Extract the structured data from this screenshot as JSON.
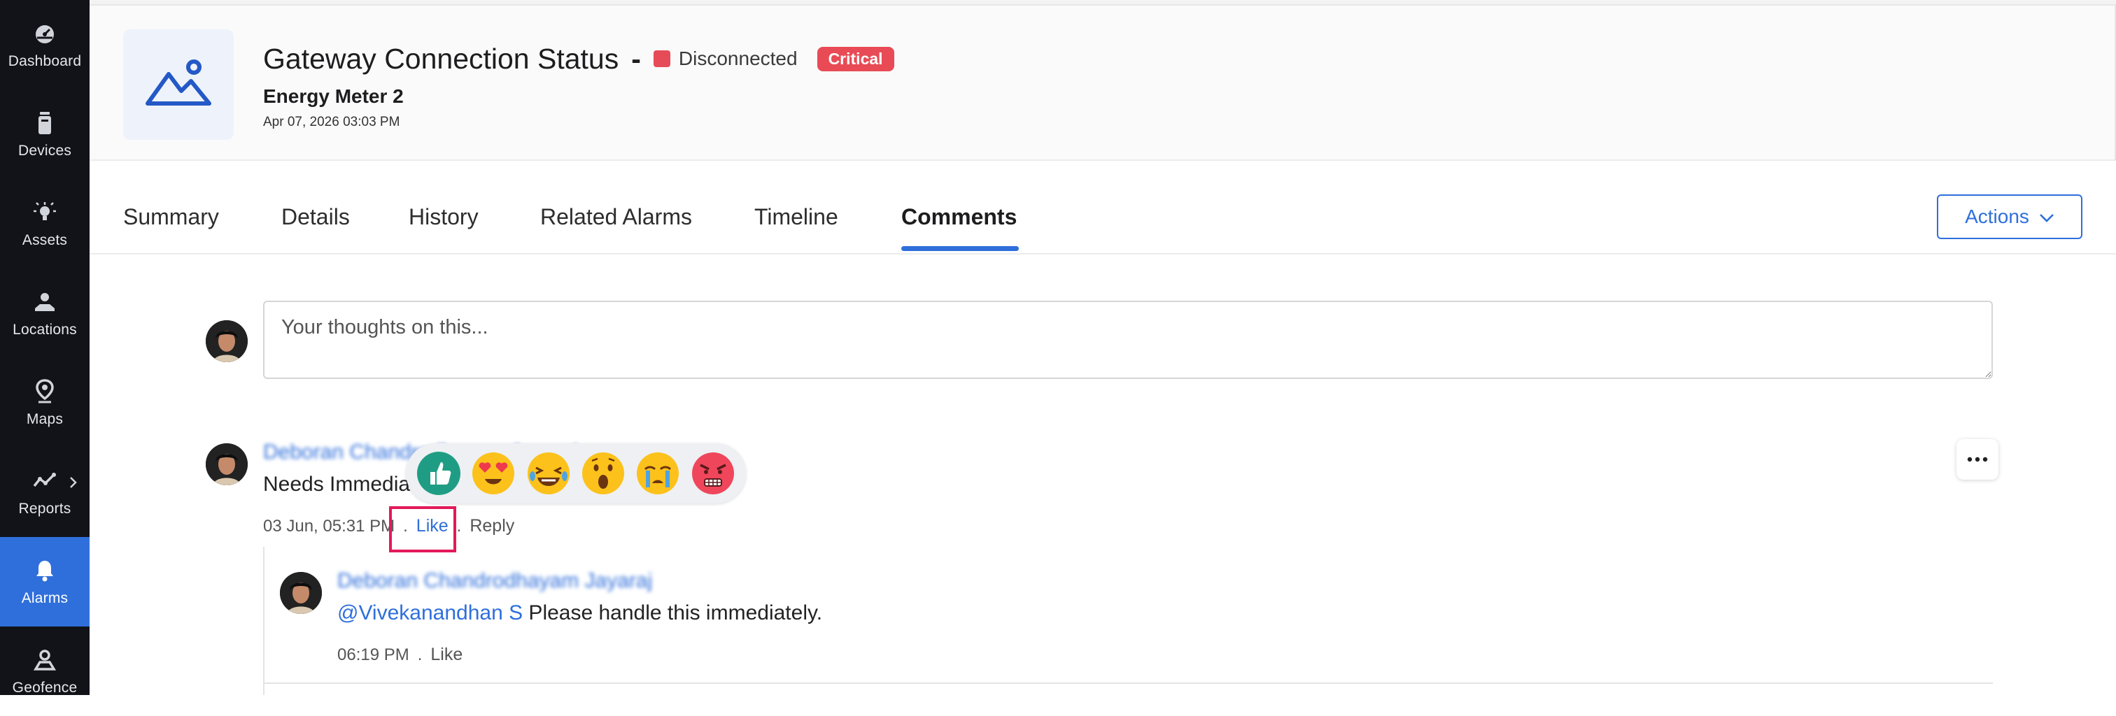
{
  "sidebar": {
    "items": [
      {
        "label": "Dashboard",
        "icon": "dashboard-icon"
      },
      {
        "label": "Devices",
        "icon": "device-icon"
      },
      {
        "label": "Assets",
        "icon": "bulb-icon"
      },
      {
        "label": "Locations",
        "icon": "location-icon"
      },
      {
        "label": "Maps",
        "icon": "map-pin-icon"
      },
      {
        "label": "Reports",
        "icon": "chart-line-icon"
      },
      {
        "label": "Alarms",
        "icon": "bell-icon"
      },
      {
        "label": "Geofence",
        "icon": "geofence-icon"
      }
    ],
    "active": "Alarms"
  },
  "header": {
    "title": "Gateway Connection Status",
    "dash": "-",
    "status": "Disconnected",
    "severity": "Critical",
    "subtitle": "Energy Meter 2",
    "timestamp": "Apr 07, 2026 03:03 PM"
  },
  "tabs": [
    {
      "label": "Summary"
    },
    {
      "label": "Details"
    },
    {
      "label": "History"
    },
    {
      "label": "Related Alarms"
    },
    {
      "label": "Timeline"
    },
    {
      "label": "Comments"
    }
  ],
  "active_tab": "Comments",
  "actions": {
    "label": "Actions"
  },
  "composer": {
    "placeholder": "Your thoughts on this..."
  },
  "comment": {
    "author": "Deboran Chandrodhayam Jayaraj",
    "text": "Needs Immedia",
    "time": "03 Jun, 05:31 PM",
    "dot": ".",
    "like": "Like",
    "reply": "Reply"
  },
  "reactions": [
    "thumbs-up",
    "heart-eyes",
    "laughing",
    "surprised",
    "crying",
    "angry"
  ],
  "reply": {
    "author": "Deboran Chandrodhayam Jayaraj",
    "mention": "@Vivekanandhan S",
    "text": " Please handle this immediately.",
    "time": "06:19 PM",
    "dot": ".",
    "like": "Like"
  },
  "colors": {
    "accent": "#2f6fdb",
    "sidebar": "#111318",
    "critical": "#e84b55",
    "highlight": "#e3195a"
  }
}
